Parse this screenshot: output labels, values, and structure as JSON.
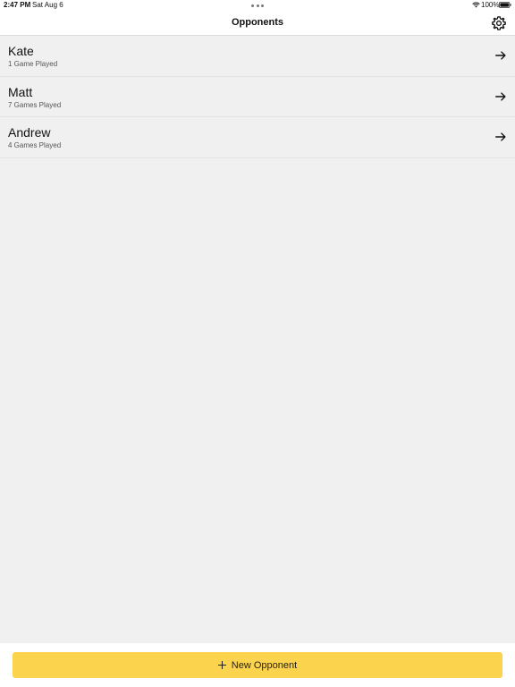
{
  "status_bar": {
    "time": "2:47 PM",
    "date": "Sat Aug 6",
    "battery": "100%"
  },
  "nav": {
    "title": "Opponents"
  },
  "opponents": [
    {
      "name": "Kate",
      "games": "1 Game Played"
    },
    {
      "name": "Matt",
      "games": "7 Games Played"
    },
    {
      "name": "Andrew",
      "games": "4 Games Played"
    }
  ],
  "actions": {
    "new_opponent_label": "New Opponent"
  },
  "colors": {
    "accent": "#fcd34d",
    "background": "#f0f0f0"
  }
}
